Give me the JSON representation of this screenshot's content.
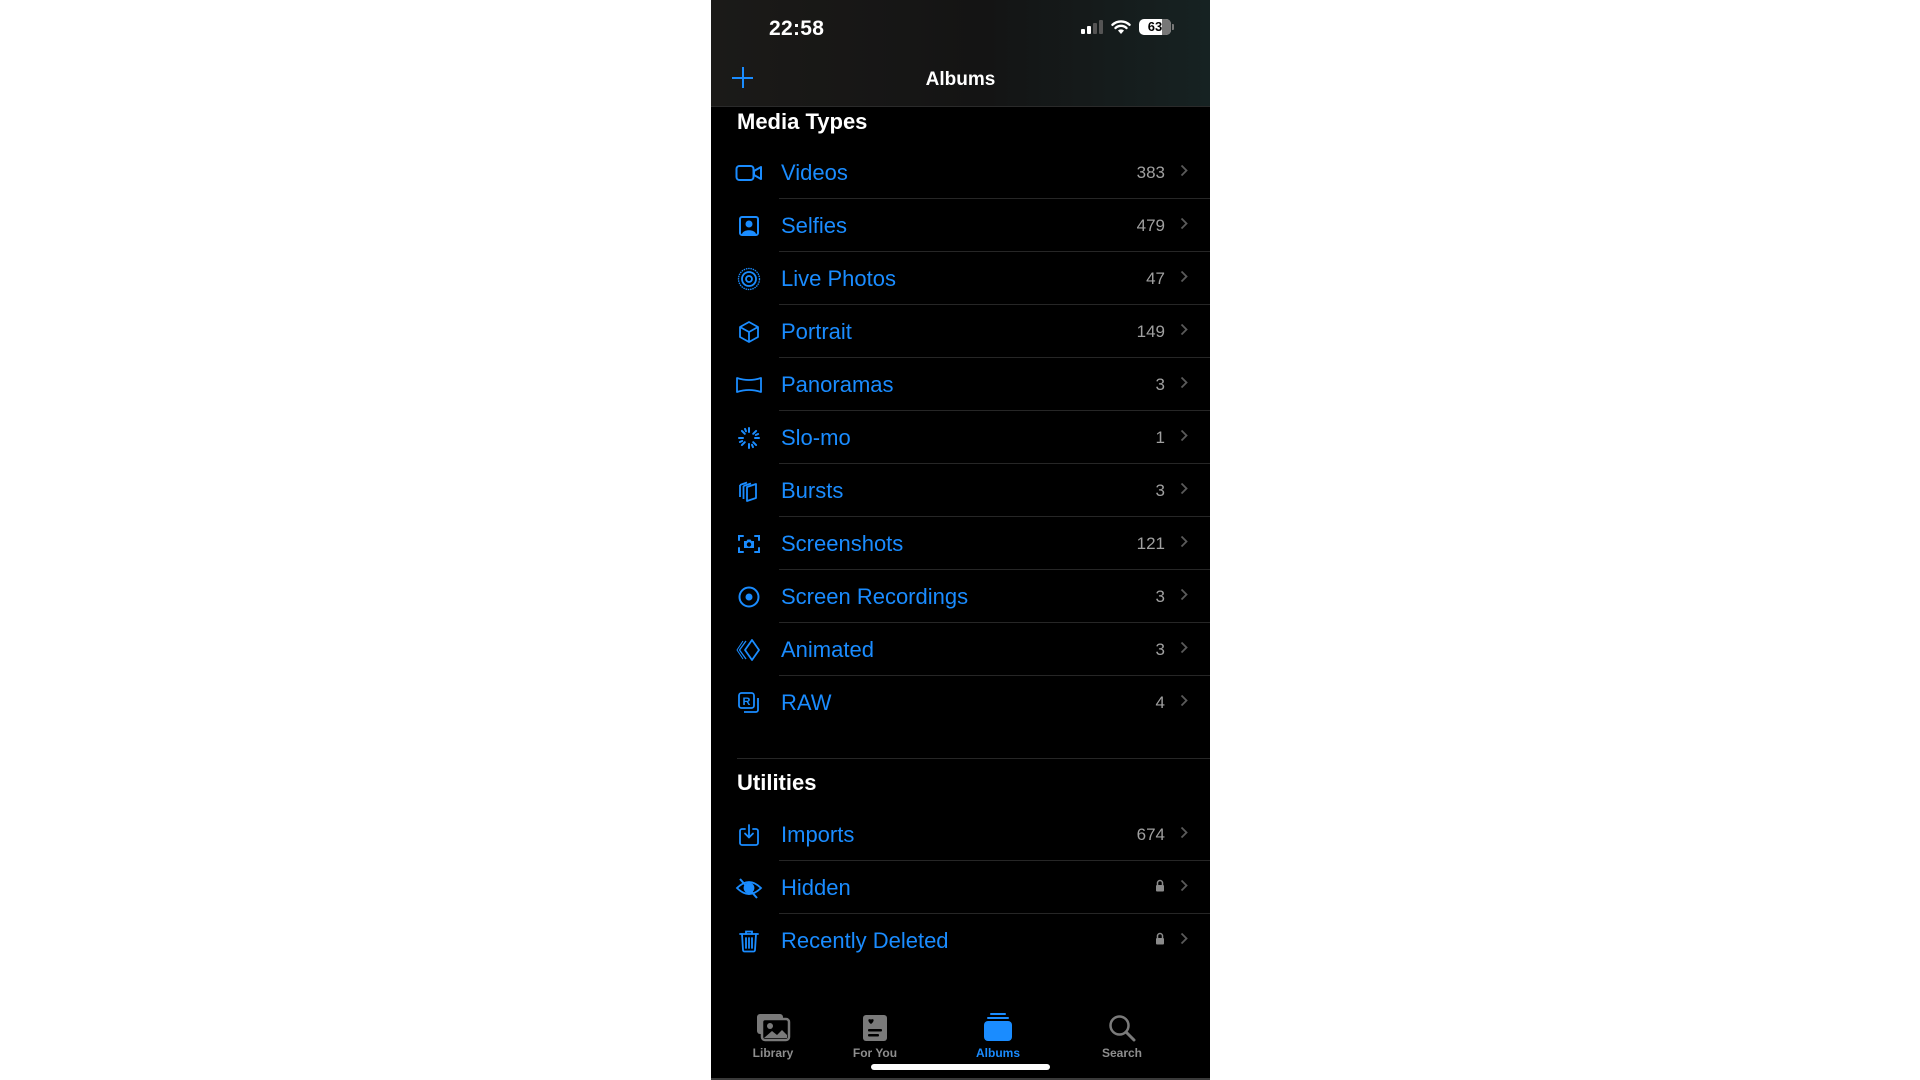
{
  "status_bar": {
    "time": "22:58",
    "signal_bars": 2,
    "signal_bars_total": 4,
    "wifi": "wifi-icon",
    "battery_percent": "63"
  },
  "nav": {
    "title": "Albums",
    "add_icon": "plus-icon"
  },
  "sections": [
    {
      "title": "Media Types",
      "items": [
        {
          "label": "Videos",
          "count": "383",
          "icon": "video-camera-icon"
        },
        {
          "label": "Selfies",
          "count": "479",
          "icon": "person-square-icon"
        },
        {
          "label": "Live Photos",
          "count": "47",
          "icon": "live-photo-icon"
        },
        {
          "label": "Portrait",
          "count": "149",
          "icon": "cube-icon"
        },
        {
          "label": "Panoramas",
          "count": "3",
          "icon": "panorama-icon"
        },
        {
          "label": "Slo-mo",
          "count": "1",
          "icon": "slowmo-icon"
        },
        {
          "label": "Bursts",
          "count": "3",
          "icon": "bursts-icon"
        },
        {
          "label": "Screenshots",
          "count": "121",
          "icon": "screenshot-camera-icon"
        },
        {
          "label": "Screen Recordings",
          "count": "3",
          "icon": "record-circle-icon"
        },
        {
          "label": "Animated",
          "count": "3",
          "icon": "animated-diamond-icon"
        },
        {
          "label": "RAW",
          "count": "4",
          "icon": "raw-icon"
        }
      ]
    },
    {
      "title": "Utilities",
      "items": [
        {
          "label": "Imports",
          "count": "674",
          "icon": "import-tray-icon"
        },
        {
          "label": "Hidden",
          "count": null,
          "locked": true,
          "icon": "eye-slash-icon"
        },
        {
          "label": "Recently Deleted",
          "count": null,
          "locked": true,
          "icon": "trash-icon"
        }
      ]
    }
  ],
  "tabbar": {
    "tabs": [
      {
        "label": "Library",
        "icon": "photo-library-icon",
        "active": false
      },
      {
        "label": "For You",
        "icon": "for-you-icon",
        "active": false
      },
      {
        "label": "Albums",
        "icon": "albums-stack-icon",
        "active": true
      },
      {
        "label": "Search",
        "icon": "search-icon",
        "active": false
      }
    ]
  },
  "colors": {
    "accent": "#1a8cff",
    "background": "#000000",
    "secondary_text": "#a0a0a0",
    "inactive_tab": "#8e8e8e"
  }
}
